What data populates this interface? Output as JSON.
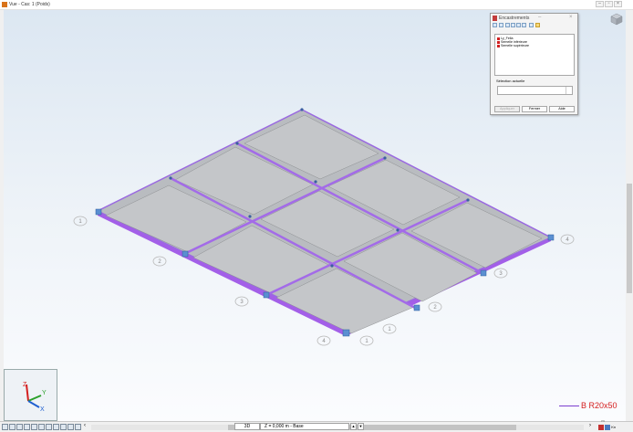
{
  "window": {
    "title": "Vue - Cas: 1 (Poids)",
    "minimize_glyph": "–",
    "maximize_glyph": "▫",
    "close_glyph": "×"
  },
  "viewport": {
    "legend_label": "B R20x50",
    "legend_color": "#7b3fcf",
    "axis_labels": {
      "z": "Z",
      "y": "Y",
      "x": "X"
    },
    "grid_labels": [
      {
        "name": "grid-label-1-left",
        "text": "1"
      },
      {
        "name": "grid-label-2-left",
        "text": "2"
      },
      {
        "name": "grid-label-3-left",
        "text": "3"
      },
      {
        "name": "grid-label-4-left",
        "text": "4"
      },
      {
        "name": "grid-label-1-front-a",
        "text": "1"
      },
      {
        "name": "grid-label-1-front-b",
        "text": "1"
      },
      {
        "name": "grid-label-2-right",
        "text": "2"
      },
      {
        "name": "grid-label-3-right",
        "text": "3"
      },
      {
        "name": "grid-label-4-right",
        "text": "4"
      }
    ]
  },
  "dialog": {
    "title": "Encastrements",
    "list_items": [
      {
        "label": "Ly_Fella",
        "color": "#d12020"
      },
      {
        "label": "Semelle inférieure",
        "color": "#d12020"
      },
      {
        "label": "Semelle supérieure",
        "color": "#d12020"
      }
    ],
    "current_selection_label": "Sélection actuelle",
    "buttons": {
      "apply": "Appliquer",
      "close": "Fermer",
      "help": "Aide"
    }
  },
  "statusbar": {
    "view_mode": "3D",
    "view_plane": "Z = 0,000 m - Base",
    "plane_prev": "▲",
    "plane_next": "▼",
    "scroll_left": "‹",
    "scroll_right": "›",
    "unit_hint": "m",
    "coords_label": "Kn"
  }
}
